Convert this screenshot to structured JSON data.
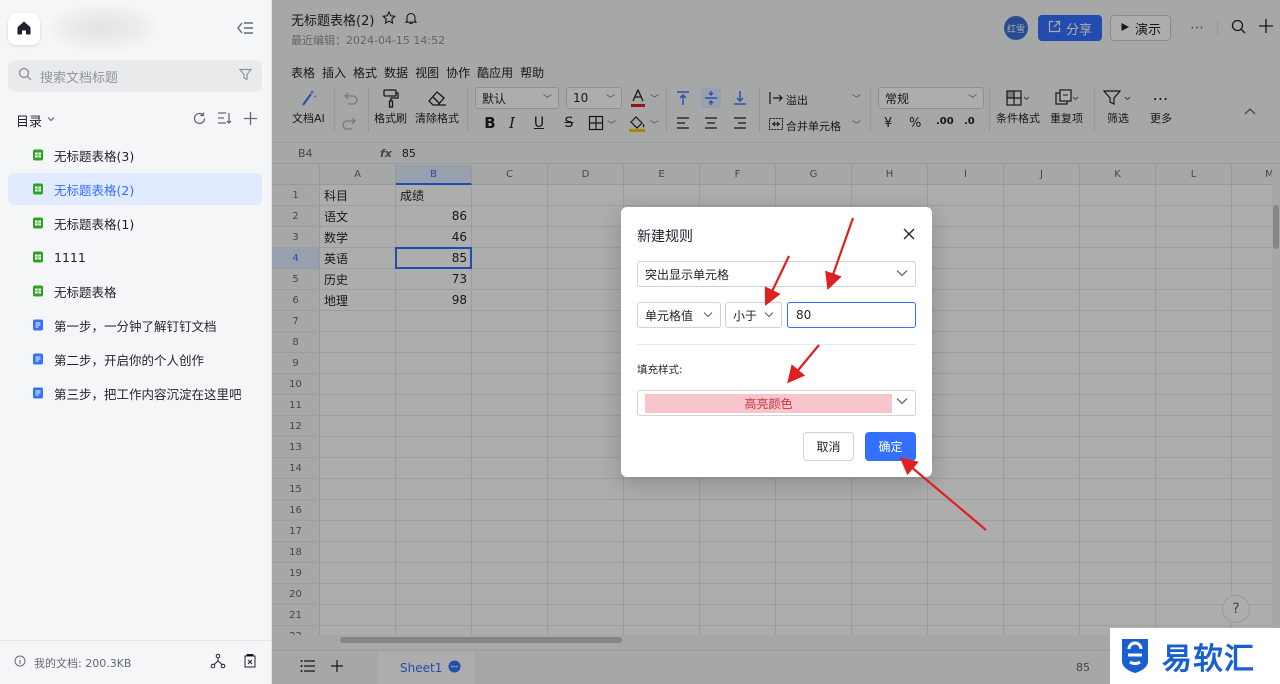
{
  "sidebar": {
    "search_placeholder": "搜索文档标题",
    "directory_label": "目录",
    "docs": [
      {
        "label": "无标题表格(3)",
        "type": "sheet"
      },
      {
        "label": "无标题表格(2)",
        "type": "sheet",
        "active": true
      },
      {
        "label": "无标题表格(1)",
        "type": "sheet"
      },
      {
        "label": "1111",
        "type": "sheet"
      },
      {
        "label": "无标题表格",
        "type": "sheet"
      },
      {
        "label": "第一步，一分钟了解钉钉文档",
        "type": "doc"
      },
      {
        "label": "第二步，开启你的个人创作",
        "type": "doc"
      },
      {
        "label": "第三步，把工作内容沉淀在这里吧",
        "type": "doc"
      }
    ],
    "footer": {
      "storage": "我的文档: 200.3KB"
    }
  },
  "header": {
    "title": "无标题表格(2)",
    "subtitle": "最近编辑：2024-04-15 14:52",
    "user_badge": "红雪",
    "share_label": "分享",
    "present_label": "演示"
  },
  "menubar": [
    "表格",
    "插入",
    "格式",
    "数据",
    "视图",
    "协作",
    "酷应用",
    "帮助"
  ],
  "toolbar": {
    "doc_ai": "文档AI",
    "format_painter": "格式刷",
    "clear_format": "清除格式",
    "font": "默认",
    "font_size": "10",
    "overflow": "溢出",
    "merge": "合并单元格",
    "number_format": "常规",
    "conditional_format": "条件格式",
    "duplicates": "重复项",
    "filter": "筛选",
    "more": "更多",
    "currency": "¥",
    "percent": "%",
    "inc_decimal": ".00",
    "dec_decimal": ".0"
  },
  "formula_bar": {
    "cell_ref": "B4",
    "fx": "fx",
    "value": "85"
  },
  "grid": {
    "columns": [
      "A",
      "B",
      "C",
      "D",
      "E",
      "F",
      "G",
      "H",
      "I",
      "J",
      "K",
      "L",
      "M"
    ],
    "rows": [
      "1",
      "2",
      "3",
      "4",
      "5",
      "6",
      "7",
      "8",
      "9",
      "10",
      "11",
      "12",
      "13",
      "14",
      "15",
      "16",
      "17",
      "18",
      "19",
      "20",
      "21",
      "22"
    ],
    "data": [
      [
        "科目",
        "成绩"
      ],
      [
        "语文",
        "86"
      ],
      [
        "数学",
        "46"
      ],
      [
        "英语",
        "85"
      ],
      [
        "历史",
        "73"
      ],
      [
        "地理",
        "98"
      ]
    ]
  },
  "sheetbar": {
    "sheet_name": "Sheet1",
    "zoom": "85"
  },
  "dialog": {
    "title": "新建规则",
    "rule_type": "突出显示单元格",
    "condition_field": "单元格值",
    "operator": "小于",
    "value": "80",
    "fill_label": "填充样式:",
    "fill_value": "高亮颜色",
    "cancel": "取消",
    "confirm": "确定"
  },
  "watermark": {
    "text": "易软汇"
  },
  "colors": {
    "accent": "#3370ff",
    "highlight_fill": "#f7c5cb",
    "highlight_text": "#c9333f",
    "arrow": "#e02020"
  }
}
